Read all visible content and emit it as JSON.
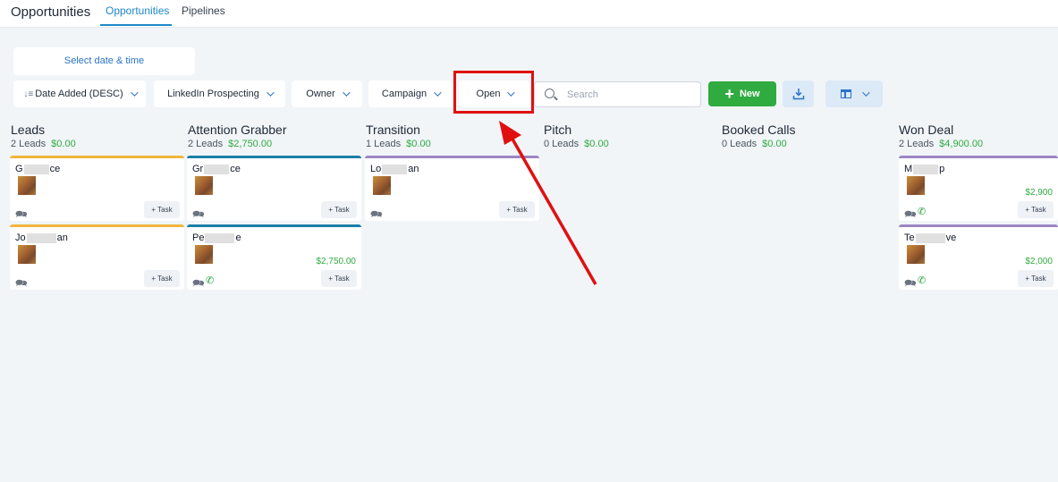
{
  "header": {
    "app_title": "Opportunities",
    "tabs": [
      {
        "label": "Opportunities",
        "active": true
      },
      {
        "label": "Pipelines",
        "active": false
      }
    ]
  },
  "date_picker": {
    "label": "Select date & time"
  },
  "filters": {
    "sort": "Date Added (DESC)",
    "pipeline": "LinkedIn Prospecting",
    "owner": "Owner",
    "campaign": "Campaign",
    "status": "Open"
  },
  "search": {
    "placeholder": "Search"
  },
  "new_button": {
    "label": "New",
    "color": "#2fab3f"
  },
  "colors": {
    "accent": "#1e88c8",
    "annotation": "#e01010",
    "amount": "#2fab3f"
  },
  "columns": [
    {
      "name": "Leads",
      "count": "2 Leads",
      "amount": "$0.00",
      "color": "#f0b63c",
      "cards": [
        {
          "name_start": "G",
          "name_end": "ce",
          "amount": "",
          "phone": false,
          "task": "+ Task"
        },
        {
          "name_start": "Jo",
          "name_end": "an",
          "amount": "",
          "phone": false,
          "task": "+ Task"
        }
      ]
    },
    {
      "name": "Attention Grabber",
      "count": "2 Leads",
      "amount": "$2,750.00",
      "color": "#1b7fa6",
      "cards": [
        {
          "name_start": "Gr",
          "name_end": "ce",
          "amount": "",
          "phone": false,
          "task": "+ Task"
        },
        {
          "name_start": "Pe",
          "name_end": "e",
          "amount": "$2,750.00",
          "phone": true,
          "task": "+ Task"
        }
      ]
    },
    {
      "name": "Transition",
      "count": "1 Leads",
      "amount": "$0.00",
      "color": "#9b86c4",
      "cards": [
        {
          "name_start": "Lo",
          "name_end": "an",
          "amount": "",
          "phone": false,
          "task": "+ Task"
        }
      ]
    },
    {
      "name": "Pitch",
      "count": "0 Leads",
      "amount": "$0.00",
      "color": "#9b86c4",
      "cards": []
    },
    {
      "name": "Booked Calls",
      "count": "0 Leads",
      "amount": "$0.00",
      "color": "#9b86c4",
      "cards": []
    },
    {
      "name": "Won Deal",
      "count": "2 Leads",
      "amount": "$4,900.00",
      "color": "#9b86c4",
      "cards": [
        {
          "name_start": "M",
          "name_end": "p",
          "amount": "$2,900",
          "phone": true,
          "task": "+ Task"
        },
        {
          "name_start": "Te",
          "name_end": "ve",
          "amount": "$2,000",
          "phone": true,
          "task": "+ Task"
        }
      ]
    }
  ]
}
